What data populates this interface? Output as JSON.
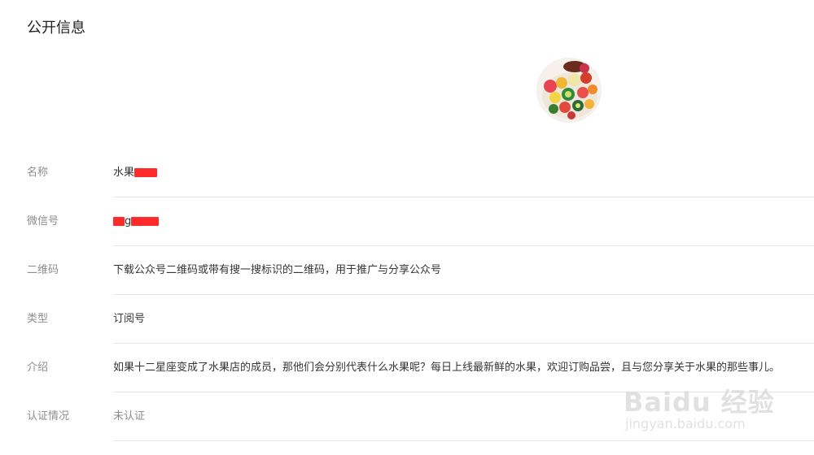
{
  "section": {
    "title": "公开信息"
  },
  "avatar": {
    "alt": "fruit-platter-avatar"
  },
  "rows": [
    {
      "label": "名称",
      "value": "水果"
    },
    {
      "label": "微信号",
      "value": "g"
    },
    {
      "label": "二维码",
      "value": "下载公众号二维码或带有搜一搜标识的二维码，用于推广与分享公众号"
    },
    {
      "label": "类型",
      "value": "订阅号"
    },
    {
      "label": "介绍",
      "value": "如果十二星座变成了水果店的成员，那他们会分别代表什么水果呢？每日上线最新鲜的水果，欢迎订购品尝，且与您分享关于水果的那些事儿。"
    },
    {
      "label": "认证情况",
      "value": "未认证"
    }
  ],
  "watermark": {
    "main": "Baidu 经验",
    "sub": "jingyan.baidu.com"
  },
  "colors": {
    "redaction": "#ff2a2a",
    "divider": "#e7e7eb",
    "label": "#8d8d8d"
  }
}
